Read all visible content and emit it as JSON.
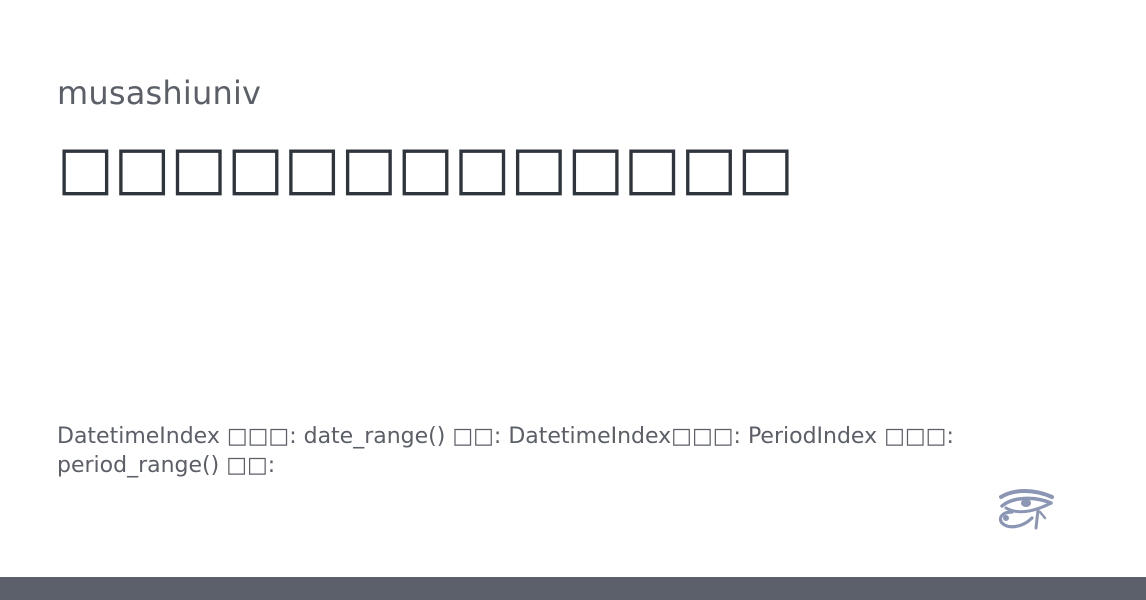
{
  "card": {
    "author": "musashiuniv",
    "title": "□□□□□□□□□□□□□",
    "description": "DatetimeIndex □□□: date_range() □□: DatetimeIndex□□□: PeriodIndex □□□: period_range() □□:",
    "logo_icon": "eye-of-horus-icon",
    "colors": {
      "background": "#ffffff",
      "title": "#2f353d",
      "text": "#5b5f68",
      "logo": "#8b96b4",
      "footer_bar": "#5b606b"
    }
  }
}
